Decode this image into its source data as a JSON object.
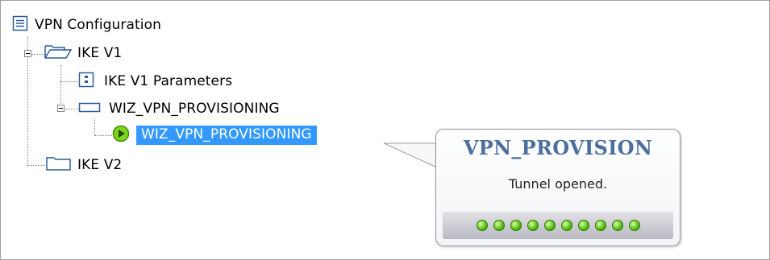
{
  "tree": {
    "root": {
      "label": "VPN Configuration",
      "icon": "list-icon"
    },
    "ike_v1": {
      "label": "IKE V1",
      "icon": "open-folder-icon"
    },
    "ike_v1_params": {
      "label": "IKE V1 Parameters",
      "icon": "parameters-icon"
    },
    "wiz_group": {
      "label": "WIZ_VPN_PROVISIONING",
      "icon": "rectangle-icon"
    },
    "wiz_tunnel": {
      "label": "WIZ_VPN_PROVISIONING",
      "icon": "green-play-icon",
      "selected": true
    },
    "ike_v2": {
      "label": "IKE V2",
      "icon": "folder-icon"
    }
  },
  "tooltip": {
    "title": "VPN_PROVISION",
    "message": "Tunnel opened.",
    "indicator_count": 10,
    "indicator_color": "#3fae00"
  },
  "colors": {
    "selection": "#3399ff",
    "tooltip_title": "#4d6fa0"
  }
}
